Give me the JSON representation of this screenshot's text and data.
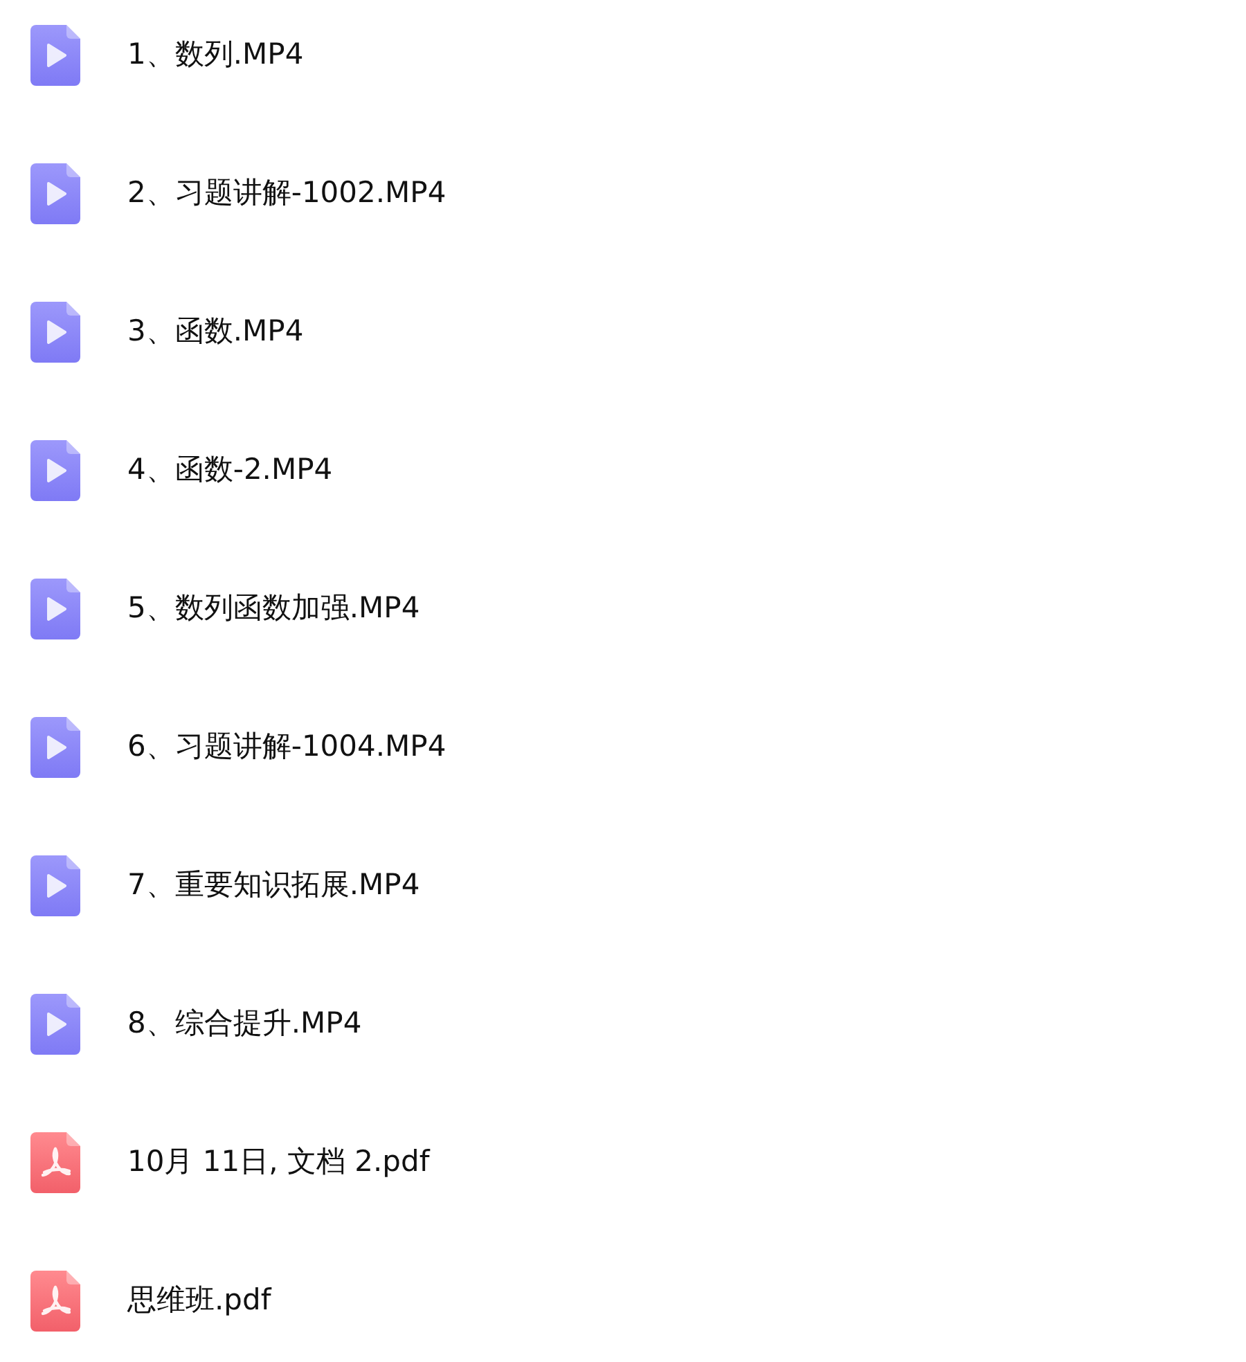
{
  "files": [
    {
      "name": "1、数列.MP4",
      "kind": "video"
    },
    {
      "name": "2、习题讲解-1002.MP4",
      "kind": "video"
    },
    {
      "name": "3、函数.MP4",
      "kind": "video"
    },
    {
      "name": "4、函数-2.MP4",
      "kind": "video"
    },
    {
      "name": "5、数列函数加强.MP4",
      "kind": "video"
    },
    {
      "name": "6、习题讲解-1004.MP4",
      "kind": "video"
    },
    {
      "name": "7、重要知识拓展.MP4",
      "kind": "video"
    },
    {
      "name": "8、综合提升.MP4",
      "kind": "video"
    },
    {
      "name": "10月 11日, 文档 2.pdf",
      "kind": "pdf"
    },
    {
      "name": "思维班.pdf",
      "kind": "pdf"
    }
  ]
}
